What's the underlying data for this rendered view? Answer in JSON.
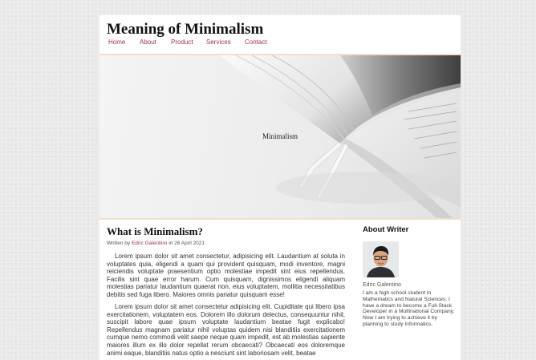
{
  "site": {
    "title": "Meaning of Minimalism"
  },
  "nav": {
    "items": [
      "Home",
      "About",
      "Product",
      "Services",
      "Contact"
    ]
  },
  "hero": {
    "caption": "Minimalism"
  },
  "article": {
    "title": "What is Minimalism?",
    "byline_prefix": "Written by ",
    "author": "Edric Galentino",
    "byline_suffix": " in 26 April 2021",
    "paragraphs": [
      "Lorem ipsum dolor sit amet consectetur, adipisicing elit. Laudantium at soluta in voluptates quia, eligendi a quam qui provident quisquam, modi inventore, magni reiciendis voluptate praesentium optio molestiae impedit sint eius repellendus. Facilis sint quae error harum. Cum quisquam, dignissimos eligendi aliquam molestias pariatur laudantium quaerat non, eius voluptatem, mollitia necessitatibus debitis sed fuga libero. Maiores omnis pariatur quisquam esse!",
      "Lorem ipsum dolor sit amet consectetur adipisicing elit. Cupiditate qui libero ipsa exercitationem, voluptatem eos. Dolorem illo dolorum delectus, consequuntur nihil, suscipit labore quae ipsum voluptate laudantium beatae fugit explicabo! Repellendus magnam pariatur nihil voluptas quidem nisi blanditiis exercitationem cumque nemo commodi velit saepe neque quam impedit, est ab molestias sapiente maiores illum ex illo dolor repellat rerum obcaecati? Obcaecati eos doloremque animi eaque, blanditiis natus optio a nesciunt sint laboriosam velit, beatae"
    ]
  },
  "aside": {
    "heading": "About Writer",
    "writer_name": "Edric Galentino",
    "bio": "I am a high school student in Mathematics and Natural Sciences. I have a dream to become a Full-Stack Developer in a Multinational Company. Now I am trying to achieve it by planning to study Informatics."
  }
}
